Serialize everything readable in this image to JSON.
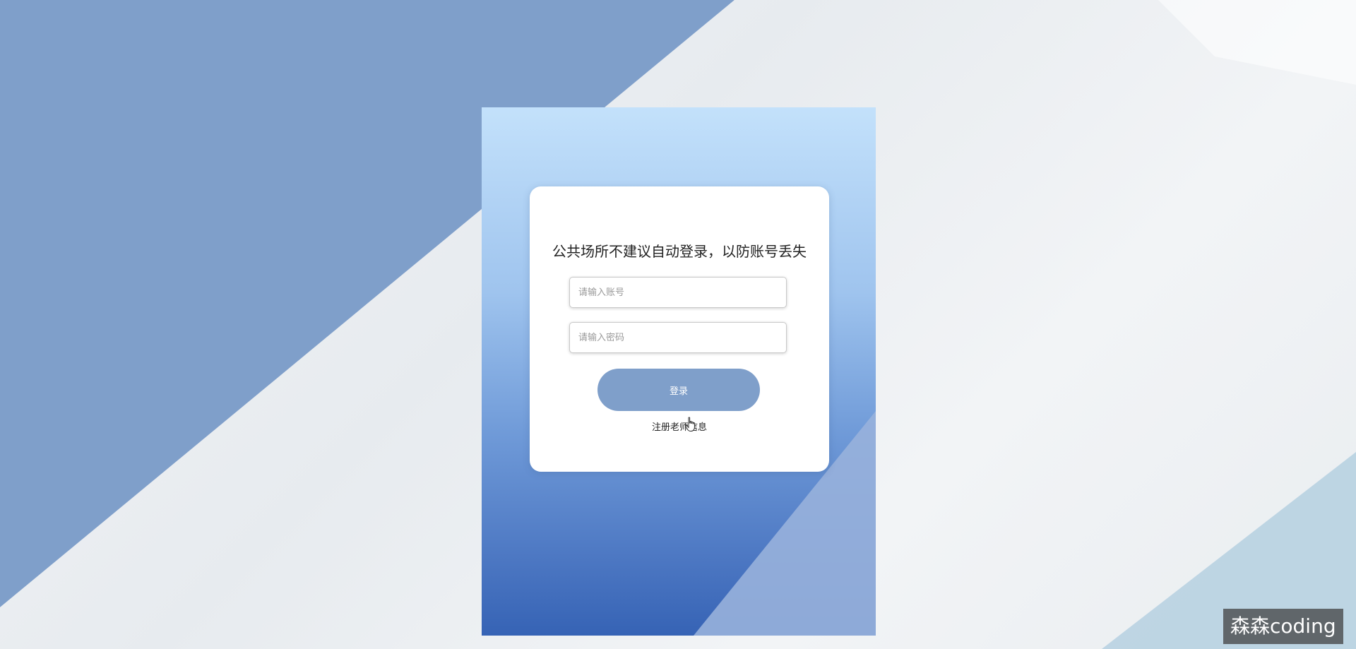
{
  "login": {
    "notice": "公共场所不建议自动登录，以防账号丢失",
    "account_placeholder": "请输入账号",
    "password_placeholder": "请输入密码",
    "login_label": "登录",
    "register_label": "注册老师信息"
  },
  "watermark": {
    "text": "森森coding"
  },
  "colors": {
    "accent": "#7f9fca",
    "background_blue": "#7f9fca",
    "panel_top": "#c3e1fb",
    "panel_bottom": "#3663b5"
  },
  "icons": {
    "cursor": "hand-pointer-icon"
  }
}
